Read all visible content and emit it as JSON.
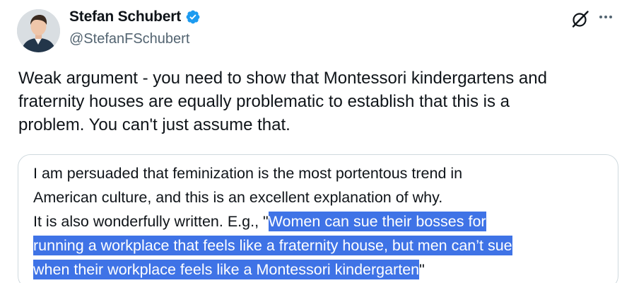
{
  "author": {
    "display_name": "Stefan Schubert",
    "handle": "@StefanFSchubert",
    "verified": true,
    "avatar_icon": "avatar-photo"
  },
  "actions": {
    "grok_icon": "grok-icon",
    "more_icon": "more-icon"
  },
  "tweet": {
    "line1": "Weak argument - you need to show that Montessori kindergartens and",
    "line2": "fraternity houses are equally problematic to establish that this is a",
    "line3": "problem. You can't just assume that."
  },
  "quote": {
    "line1": "I am persuaded that feminization is the most portentous trend in",
    "line2": "American culture, and this is an excellent explanation of why.",
    "line3_plain": "It is also wonderfully written. E.g., \"",
    "line3_highlight": "Women can sue their bosses for",
    "line4_highlight": "running a workplace that feels like a fraternity house, but men can’t sue",
    "line5_highlight": "when their workplace feels like a Montessori kindergarten",
    "line5_plain": "\""
  },
  "colors": {
    "verified": "#1d9bf0",
    "highlight": "#3f73e6",
    "secondary_text": "#536471",
    "border": "#cfd9de"
  }
}
